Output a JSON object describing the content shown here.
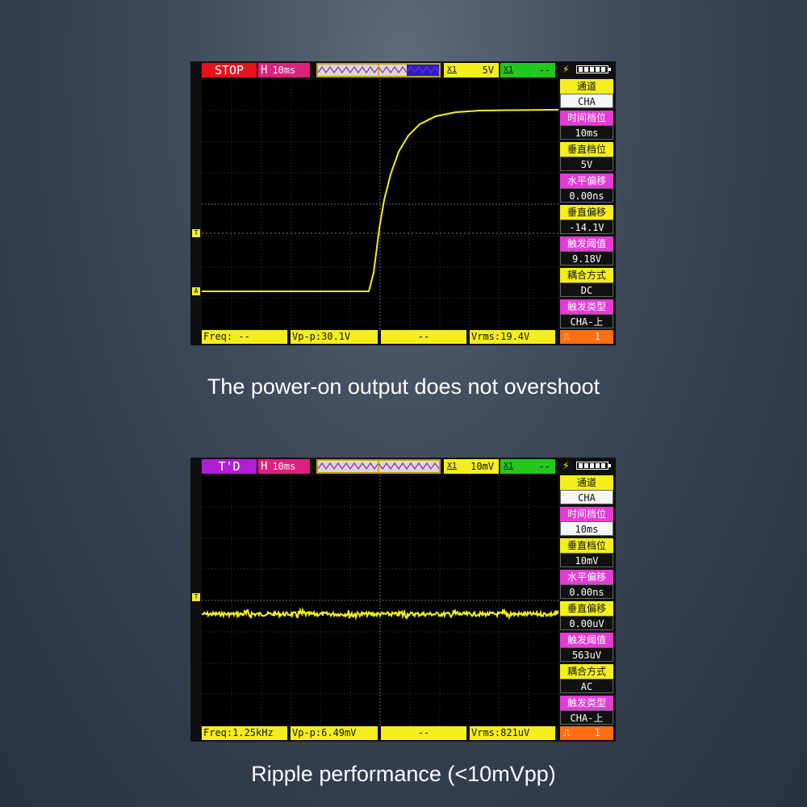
{
  "scopes": [
    {
      "status": "STOP",
      "timebase_label": "H",
      "timebase": "10ms",
      "ch1_label": "X1",
      "ch1_volts": "5V",
      "ch2_label": "X1",
      "ch2_volts": "--",
      "side": [
        {
          "label": "通道",
          "value": "CHA"
        },
        {
          "label": "时间档位",
          "value": "10ms"
        },
        {
          "label": "垂直档位",
          "value": "5V"
        },
        {
          "label": "水平偏移",
          "value": "0.00ns"
        },
        {
          "label": "垂直偏移",
          "value": "-14.1V"
        },
        {
          "label": "触发阈值",
          "value": "9.18V"
        },
        {
          "label": "耦合方式",
          "value": "DC"
        },
        {
          "label": "触发类型",
          "value": "CHA-上"
        }
      ],
      "freq": "Freq: --",
      "vpp": "Vp-p:30.1V",
      "mid": "--",
      "vrms": "Vrms:19.4V",
      "run_value": "1",
      "marker_t": "T",
      "marker_a": "A",
      "caption": "The power-on output does not overshoot",
      "colors": {
        "trace": "#f4ef1a",
        "status": "#e8121c"
      }
    },
    {
      "status": "T'D",
      "timebase_label": "H",
      "timebase": "10ms",
      "ch1_label": "X1",
      "ch1_volts": "10mV",
      "ch2_label": "X1",
      "ch2_volts": "--",
      "side": [
        {
          "label": "通道",
          "value": "CHA"
        },
        {
          "label": "时间档位",
          "value": "10ms"
        },
        {
          "label": "垂直档位",
          "value": "10mV"
        },
        {
          "label": "水平偏移",
          "value": "0.00ns"
        },
        {
          "label": "垂直偏移",
          "value": "0.00uV"
        },
        {
          "label": "触发阈值",
          "value": "563uV"
        },
        {
          "label": "耦合方式",
          "value": "AC"
        },
        {
          "label": "触发类型",
          "value": "CHA-上"
        }
      ],
      "freq": "Freq:1.25kHz",
      "vpp": "Vp-p:6.49mV",
      "mid": "--",
      "vrms": "Vrms:821uV",
      "run_value": "1",
      "marker_t": "T",
      "caption": "Ripple performance (<10mVpp)",
      "colors": {
        "trace": "#f4ef1a",
        "status": "#b11ed6"
      }
    }
  ]
}
